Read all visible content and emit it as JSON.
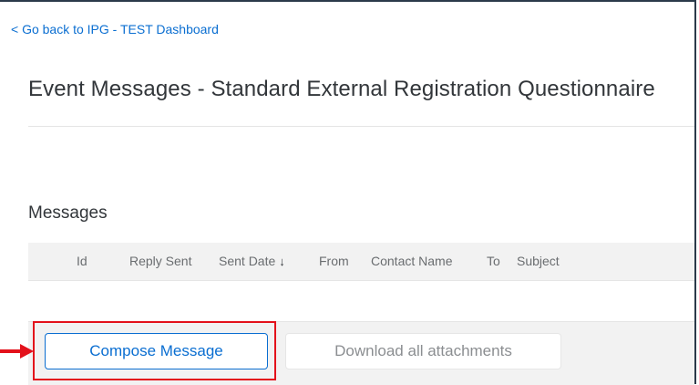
{
  "nav": {
    "back_link": "< Go back to IPG - TEST Dashboard"
  },
  "page": {
    "title": "Event Messages - Standard External Registration Questionnaire"
  },
  "messages": {
    "section_title": "Messages",
    "columns": [
      "Id",
      "Reply Sent",
      "Sent Date",
      "From",
      "Contact Name",
      "To",
      "Subject"
    ],
    "sort_icon": "arrow-down-icon",
    "sort_glyph": "↓"
  },
  "toolbar": {
    "compose_label": "Compose Message",
    "download_label": "Download all attachments"
  },
  "annotation": {
    "highlight_color": "#e3111b",
    "arrow_icon": "arrow-right-icon"
  },
  "colors": {
    "accent": "#0a6ed1",
    "header_bg": "#f2f2f2",
    "text": "#32363a"
  }
}
